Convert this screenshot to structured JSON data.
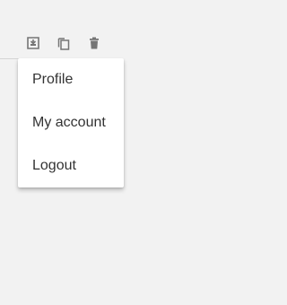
{
  "toolbar": {
    "icons": [
      "download-icon",
      "copy-icon",
      "trash-icon"
    ],
    "icon_color": "#757575"
  },
  "menu": {
    "items": [
      {
        "label": "Profile"
      },
      {
        "label": "My account"
      },
      {
        "label": "Logout"
      }
    ],
    "background": "#ffffff",
    "text_color": "#333333"
  },
  "page": {
    "background": "#f2f2f2"
  }
}
